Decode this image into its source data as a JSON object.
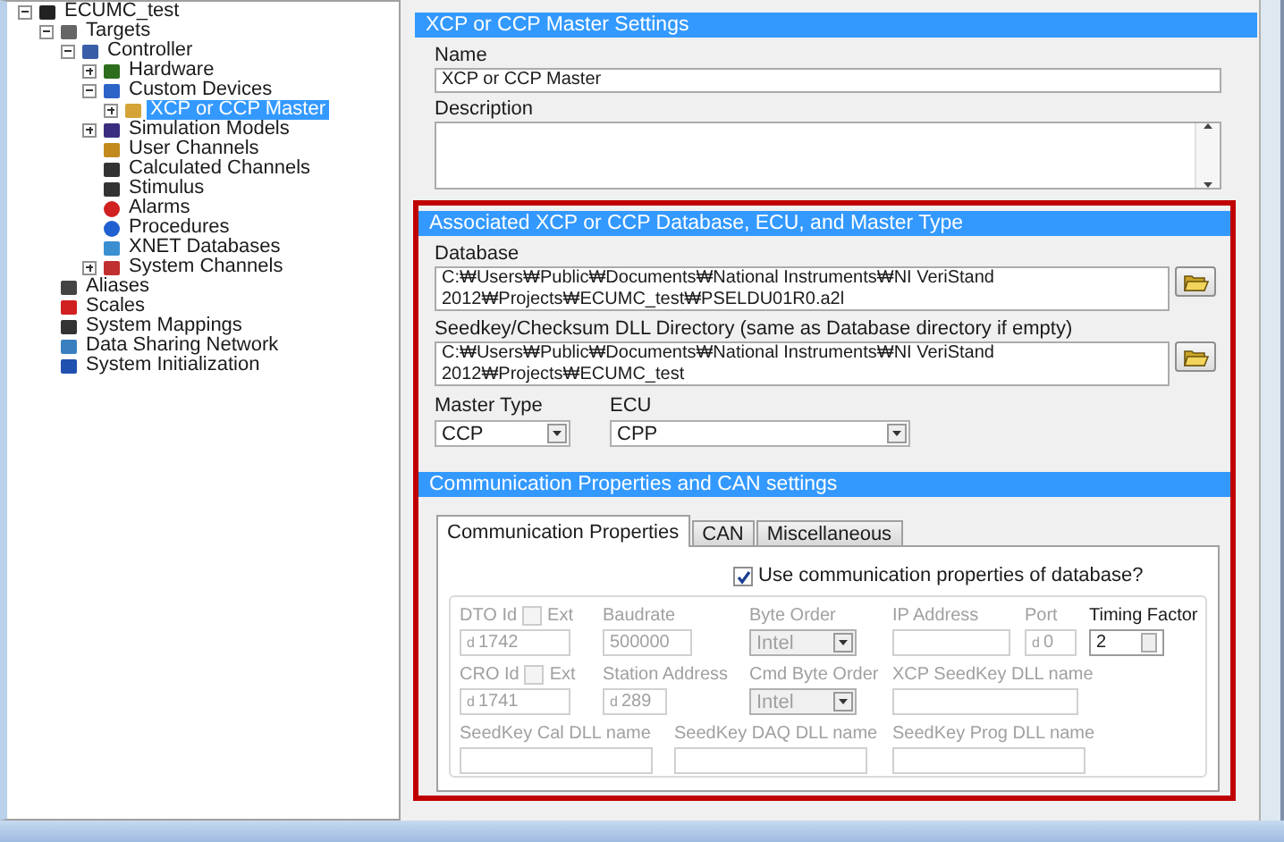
{
  "tree": [
    {
      "label": "ECUMC_test",
      "kind": "project",
      "expanded": true,
      "selected": false,
      "children": [
        {
          "label": "Targets",
          "kind": "targets",
          "expanded": true,
          "selected": false,
          "children": [
            {
              "label": "Controller",
              "kind": "controller",
              "expanded": true,
              "selected": false,
              "children": [
                {
                  "label": "Hardware",
                  "kind": "hardware",
                  "expanded": false,
                  "selected": false
                },
                {
                  "label": "Custom Devices",
                  "kind": "custom",
                  "expanded": true,
                  "selected": false,
                  "children": [
                    {
                      "label": "XCP or CCP Master",
                      "kind": "device",
                      "expanded": false,
                      "selected": true
                    }
                  ]
                },
                {
                  "label": "Simulation Models",
                  "kind": "models",
                  "expanded": false,
                  "selected": false
                },
                {
                  "label": "User Channels",
                  "kind": "user",
                  "selected": false
                },
                {
                  "label": "Calculated Channels",
                  "kind": "calc",
                  "selected": false
                },
                {
                  "label": "Stimulus",
                  "kind": "stimulus",
                  "selected": false
                },
                {
                  "label": "Alarms",
                  "kind": "alarms",
                  "selected": false
                },
                {
                  "label": "Procedures",
                  "kind": "procedures",
                  "selected": false
                },
                {
                  "label": "XNET Databases",
                  "kind": "xnet",
                  "selected": false
                },
                {
                  "label": "System Channels",
                  "kind": "syschan",
                  "expanded": false,
                  "selected": false
                }
              ]
            }
          ]
        },
        {
          "label": "Aliases",
          "kind": "aliases",
          "selected": false
        },
        {
          "label": "Scales",
          "kind": "scales",
          "selected": false
        },
        {
          "label": "System Mappings",
          "kind": "mappings",
          "selected": false
        },
        {
          "label": "Data Sharing Network",
          "kind": "network",
          "selected": false
        },
        {
          "label": "System Initialization",
          "kind": "init",
          "selected": false
        }
      ]
    }
  ],
  "settings": {
    "title": "XCP or CCP Master Settings",
    "name_label": "Name",
    "name_value": "XCP or CCP Master",
    "description_label": "Description"
  },
  "association": {
    "title": "Associated XCP or CCP Database, ECU, and Master Type",
    "database_label": "Database",
    "database_value": "C:₩Users₩Public₩Documents₩National Instruments₩NI VeriStand 2012₩Projects₩ECUMC_test₩PSELDU01R0.a2l",
    "seedkey_label": "Seedkey/Checksum DLL Directory (same as Database directory if empty)",
    "seedkey_value": "C:₩Users₩Public₩Documents₩National Instruments₩NI VeriStand 2012₩Projects₩ECUMC_test",
    "master_type_label": "Master Type",
    "master_type_value": "CCP",
    "ecu_label": "ECU",
    "ecu_value": "CPP"
  },
  "communication": {
    "title": "Communication Properties and CAN settings",
    "tabs": [
      {
        "label": "Communication Properties",
        "selected": true
      },
      {
        "label": "CAN",
        "selected": false
      },
      {
        "label": "Miscellaneous",
        "selected": false
      }
    ],
    "use_database": {
      "label": "Use communication properties of database?",
      "checked": true
    },
    "field_lines": [
      [
        {
          "label": "DTO Id",
          "kind": "numeric",
          "radix": "d",
          "value": "1742",
          "disabled": true,
          "ext": {
            "label": "Ext",
            "checked": false
          }
        },
        {
          "label": "Baudrate",
          "kind": "text",
          "value": "500000",
          "disabled": true
        },
        {
          "label": "Byte Order",
          "kind": "select",
          "value": "Intel",
          "disabled": true
        },
        {
          "label": "IP Address",
          "kind": "text",
          "disabled": true
        },
        {
          "label": "Port",
          "kind": "numeric",
          "radix": "d",
          "value": "0",
          "disabled": true
        },
        {
          "label": "Timing Factor",
          "kind": "spin",
          "value": "2",
          "disabled": false
        }
      ],
      [
        {
          "label": "CRO Id",
          "kind": "numeric",
          "radix": "d",
          "value": "1741",
          "disabled": true,
          "ext": {
            "label": "Ext",
            "checked": false
          }
        },
        {
          "label": "Station Address",
          "kind": "numeric",
          "radix": "d",
          "value": "289",
          "disabled": true
        },
        {
          "label": "Cmd Byte Order",
          "kind": "select",
          "value": "Intel",
          "disabled": true
        },
        {
          "label": "XCP SeedKey DLL name",
          "kind": "text",
          "disabled": true
        }
      ],
      [
        {
          "label": "SeedKey Cal DLL name",
          "kind": "text",
          "disabled": true
        },
        {
          "label": "SeedKey DAQ DLL name",
          "kind": "text",
          "disabled": true
        },
        {
          "label": "SeedKey Prog DLL name",
          "kind": "text",
          "disabled": true
        }
      ]
    ]
  }
}
